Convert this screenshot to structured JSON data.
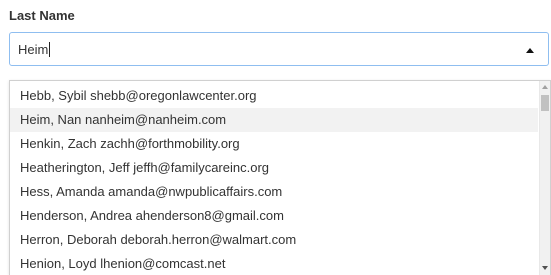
{
  "field": {
    "label": "Last Name",
    "value": "Heim"
  },
  "dropdown": {
    "items": [
      "Hebb, Sybil shebb@oregonlawcenter.org",
      "Heim, Nan nanheim@nanheim.com",
      "Henkin, Zach zachh@forthmobility.org",
      "Heatherington, Jeff jeffh@familycareinc.org",
      "Hess, Amanda amanda@nwpublicaffairs.com",
      "Henderson, Andrea ahenderson8@gmail.com",
      "Herron, Deborah deborah.herron@walmart.com",
      "Henion, Loyd lhenion@comcast.net"
    ],
    "active_index": 1
  },
  "icons": {
    "dropdown_toggle": "triangle-up-icon",
    "scroll_up": "scroll-up-arrow-icon",
    "scroll_down": "scroll-down-arrow-icon"
  }
}
